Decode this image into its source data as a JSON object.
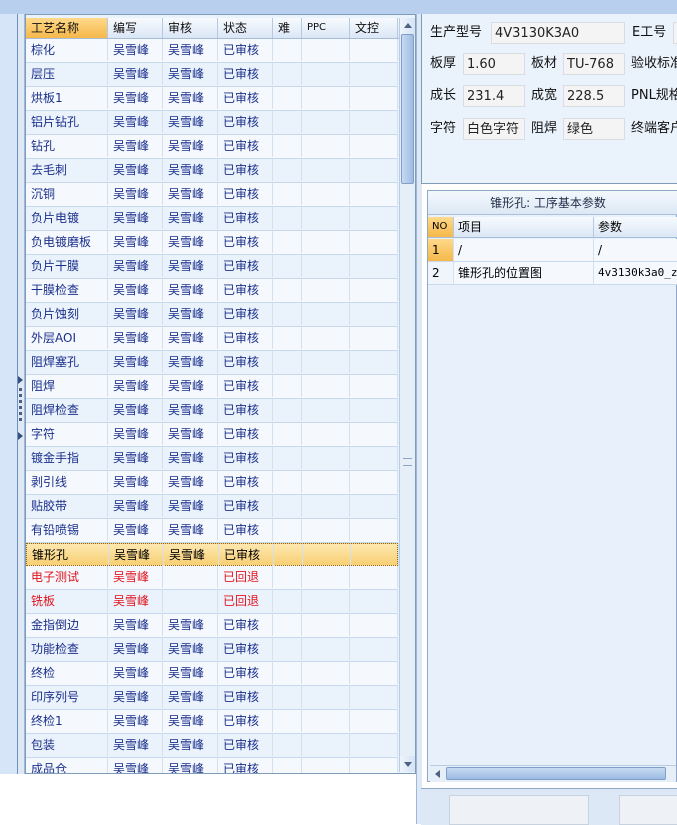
{
  "grid": {
    "columns": [
      "工艺名称",
      "编写",
      "审核",
      "状态",
      "难",
      "PPC",
      "文控"
    ],
    "rows": [
      [
        "棕化",
        "吴雪峰",
        "吴雪峰",
        "已审核"
      ],
      [
        "层压",
        "吴雪峰",
        "吴雪峰",
        "已审核"
      ],
      [
        "烘板1",
        "吴雪峰",
        "吴雪峰",
        "已审核"
      ],
      [
        "铝片钻孔",
        "吴雪峰",
        "吴雪峰",
        "已审核"
      ],
      [
        "钻孔",
        "吴雪峰",
        "吴雪峰",
        "已审核"
      ],
      [
        "去毛刺",
        "吴雪峰",
        "吴雪峰",
        "已审核"
      ],
      [
        "沉铜",
        "吴雪峰",
        "吴雪峰",
        "已审核"
      ],
      [
        "负片电镀",
        "吴雪峰",
        "吴雪峰",
        "已审核"
      ],
      [
        "负电镀磨板",
        "吴雪峰",
        "吴雪峰",
        "已审核"
      ],
      [
        "负片干膜",
        "吴雪峰",
        "吴雪峰",
        "已审核"
      ],
      [
        "干膜检查",
        "吴雪峰",
        "吴雪峰",
        "已审核"
      ],
      [
        "负片蚀刻",
        "吴雪峰",
        "吴雪峰",
        "已审核"
      ],
      [
        "外层AOI",
        "吴雪峰",
        "吴雪峰",
        "已审核"
      ],
      [
        "阻焊塞孔",
        "吴雪峰",
        "吴雪峰",
        "已审核"
      ],
      [
        "阻焊",
        "吴雪峰",
        "吴雪峰",
        "已审核"
      ],
      [
        "阻焊检查",
        "吴雪峰",
        "吴雪峰",
        "已审核"
      ],
      [
        "字符",
        "吴雪峰",
        "吴雪峰",
        "已审核"
      ],
      [
        "镀金手指",
        "吴雪峰",
        "吴雪峰",
        "已审核"
      ],
      [
        "剥引线",
        "吴雪峰",
        "吴雪峰",
        "已审核"
      ],
      [
        "贴胶带",
        "吴雪峰",
        "吴雪峰",
        "已审核"
      ],
      [
        "有铅喷锡",
        "吴雪峰",
        "吴雪峰",
        "已审核"
      ],
      [
        "锥形孔",
        "吴雪峰",
        "吴雪峰",
        "已审核"
      ],
      [
        "电子测试",
        "吴雪峰",
        "",
        "已回退"
      ],
      [
        "铣板",
        "吴雪峰",
        "",
        "已回退"
      ],
      [
        "金指倒边",
        "吴雪峰",
        "吴雪峰",
        "已审核"
      ],
      [
        "功能检查",
        "吴雪峰",
        "吴雪峰",
        "已审核"
      ],
      [
        "终检",
        "吴雪峰",
        "吴雪峰",
        "已审核"
      ],
      [
        "印序列号",
        "吴雪峰",
        "吴雪峰",
        "已审核"
      ],
      [
        "终检1",
        "吴雪峰",
        "吴雪峰",
        "已审核"
      ],
      [
        "包装",
        "吴雪峰",
        "吴雪峰",
        "已审核"
      ],
      [
        "成品仓",
        "吴雪峰",
        "吴雪峰",
        "已审核"
      ]
    ],
    "selected_index": 21,
    "returned_indices": [
      22,
      23
    ]
  },
  "info": {
    "model_label": "生产型号",
    "model_value": "4V3130K3A0",
    "eno_label": "E工号",
    "thickness_label": "板厚",
    "thickness_value": "1.60",
    "material_label": "板材",
    "material_value": "TU-768",
    "accept_label": "验收标准",
    "length_label": "成长",
    "length_value": "231.4",
    "width_label": "成宽",
    "width_value": "228.5",
    "pnl_label": "PNL规格",
    "char_label": "字符",
    "char_value": "白色字符",
    "mask_label": "阻焊",
    "mask_value": "绿色",
    "customer_label": "终端客户"
  },
  "params": {
    "title": "锥形孔: 工序基本参数",
    "columns": [
      "NO",
      "项目",
      "参数"
    ],
    "rows": [
      [
        "1",
        "/",
        "/"
      ],
      [
        "2",
        "锥形孔的位置图",
        "4v3130k3a0_z"
      ]
    ]
  },
  "colors": {
    "text_blue": "#1a2f8a",
    "text_red": "#e0141e",
    "selection": "#f8cf74",
    "panel_bg": "#eaf2fc"
  }
}
